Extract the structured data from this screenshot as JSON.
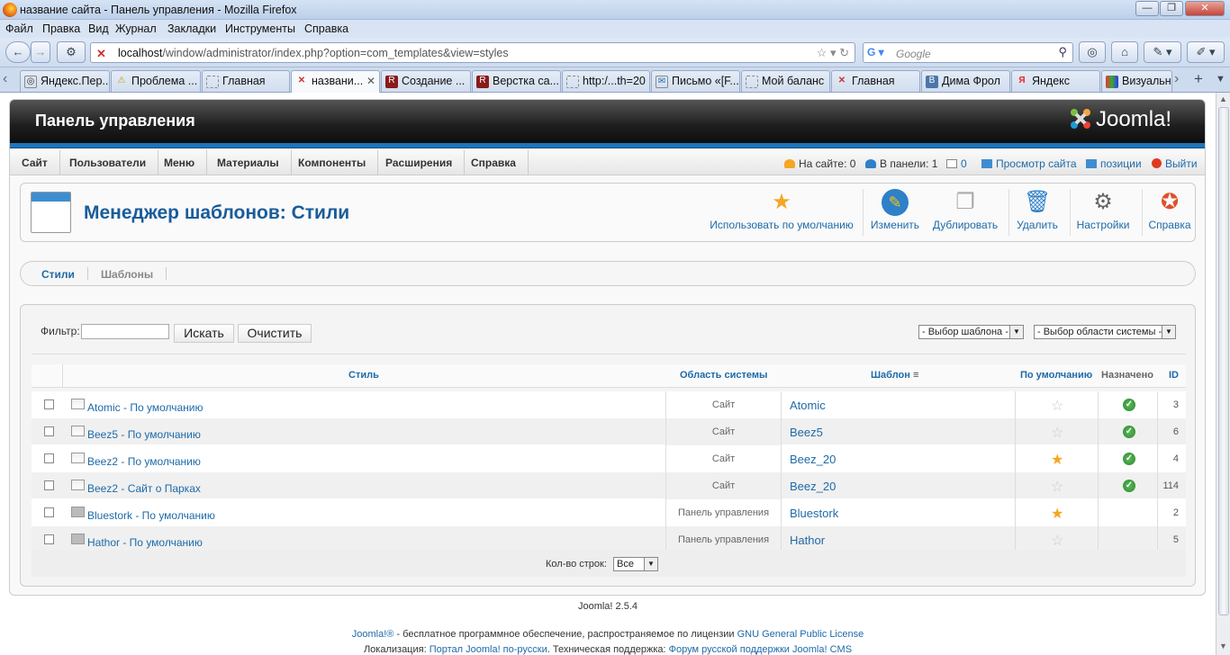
{
  "window": {
    "title": "название сайта - Панель управления - Mozilla Firefox",
    "controls": [
      "—",
      "❐",
      "✕"
    ]
  },
  "menubar": [
    "Файл",
    "Правка",
    "Вид",
    "Журнал",
    "Закладки",
    "Инструменты",
    "Справка"
  ],
  "navbar": {
    "url_host": "localhost",
    "url_path": "/window/administrator/index.php?option=com_templates&view=styles",
    "search_placeholder": "Google"
  },
  "tabs": [
    {
      "label": "Яндекс.Пер...",
      "icon": "yandex-icon"
    },
    {
      "label": "Проблема ...",
      "icon": "warning-icon"
    },
    {
      "label": "Главная",
      "icon": "page-icon"
    },
    {
      "label": "названи...",
      "icon": "joomla-icon",
      "active": true
    },
    {
      "label": "Создание ...",
      "icon": "r-icon"
    },
    {
      "label": "Верстка са...",
      "icon": "r-icon"
    },
    {
      "label": "http:/...th=20",
      "icon": "page-icon"
    },
    {
      "label": "Письмо «[F...",
      "icon": "mail-icon"
    },
    {
      "label": "Мой баланс",
      "icon": "page-icon"
    },
    {
      "label": "Главная",
      "icon": "joomla-icon"
    },
    {
      "label": "Дима Фрол",
      "icon": "vk-icon"
    },
    {
      "label": "Яндекс",
      "icon": "yandex-icon"
    },
    {
      "label": "Визуальн",
      "icon": "grid-icon"
    }
  ],
  "header": {
    "title": "Панель управления",
    "logo_text": "Joomla!"
  },
  "admin_menu": [
    "Сайт",
    "Пользователи",
    "Меню",
    "Материалы",
    "Компоненты",
    "Расширения",
    "Справка"
  ],
  "status": {
    "on_site": "На сайте: 0",
    "in_panel": "В панели: 1",
    "messages": "0",
    "view_site": "Просмотр сайта",
    "positions": "позиции",
    "logout": "Выйти"
  },
  "toolbar": {
    "title": "Менеджер шаблонов: Стили",
    "buttons": [
      "Использовать по умолчанию",
      "Изменить",
      "Дублировать",
      "Удалить",
      "Настройки",
      "Справка"
    ]
  },
  "subnav": {
    "styles": "Стили",
    "templates": "Шаблоны"
  },
  "filter": {
    "label": "Фильтр:",
    "value": "",
    "search_btn": "Искать",
    "clear_btn": "Очистить",
    "template_select": "- Выбор шаблона -",
    "client_select": "- Выбор области системы -"
  },
  "table": {
    "headers": {
      "style": "Стиль",
      "client": "Область системы",
      "template": "Шаблон",
      "default": "По умолчанию",
      "assigned": "Назначено",
      "id": "ID"
    },
    "rows": [
      {
        "style": "Atomic - По умолчанию",
        "client": "Сайт",
        "template": "Atomic",
        "default": false,
        "assigned": true,
        "id": "3"
      },
      {
        "style": "Beez5 - По умолчанию",
        "client": "Сайт",
        "template": "Beez5",
        "default": false,
        "assigned": true,
        "id": "6"
      },
      {
        "style": "Beez2 - По умолчанию",
        "client": "Сайт",
        "template": "Beez_20",
        "default": true,
        "assigned": true,
        "id": "4"
      },
      {
        "style": "Beez2 - Сайт о Парках",
        "client": "Сайт",
        "template": "Beez_20",
        "default": false,
        "assigned": true,
        "id": "114"
      },
      {
        "style": "Bluestork - По умолчанию",
        "client": "Панель управления",
        "template": "Bluestork",
        "default": true,
        "assigned": false,
        "id": "2"
      },
      {
        "style": "Hathor - По умолчанию",
        "client": "Панель управления",
        "template": "Hathor",
        "default": false,
        "assigned": false,
        "id": "5"
      }
    ]
  },
  "pager": {
    "label": "Кол-во строк:",
    "value": "Все"
  },
  "footer": {
    "version": "Joomla! 2.5.4",
    "line1_pre": "Joomla!®",
    "line1_mid": " - бесплатное программное обеспечение, распространяемое по лицензии ",
    "line1_link": "GNU General Public License",
    "line2_pre": "Локализация: ",
    "line2_link1": "Портал Joomla! по-русски",
    "line2_mid": ". Техническая поддержка: ",
    "line2_link2": "Форум русской поддержки Joomla! CMS"
  },
  "colors": {
    "accent": "#1e74b9",
    "link": "#1e6aa8",
    "header_dark": "#1e1e1e",
    "star_gold": "#f5a623",
    "check_green": "#2b8a2b"
  }
}
